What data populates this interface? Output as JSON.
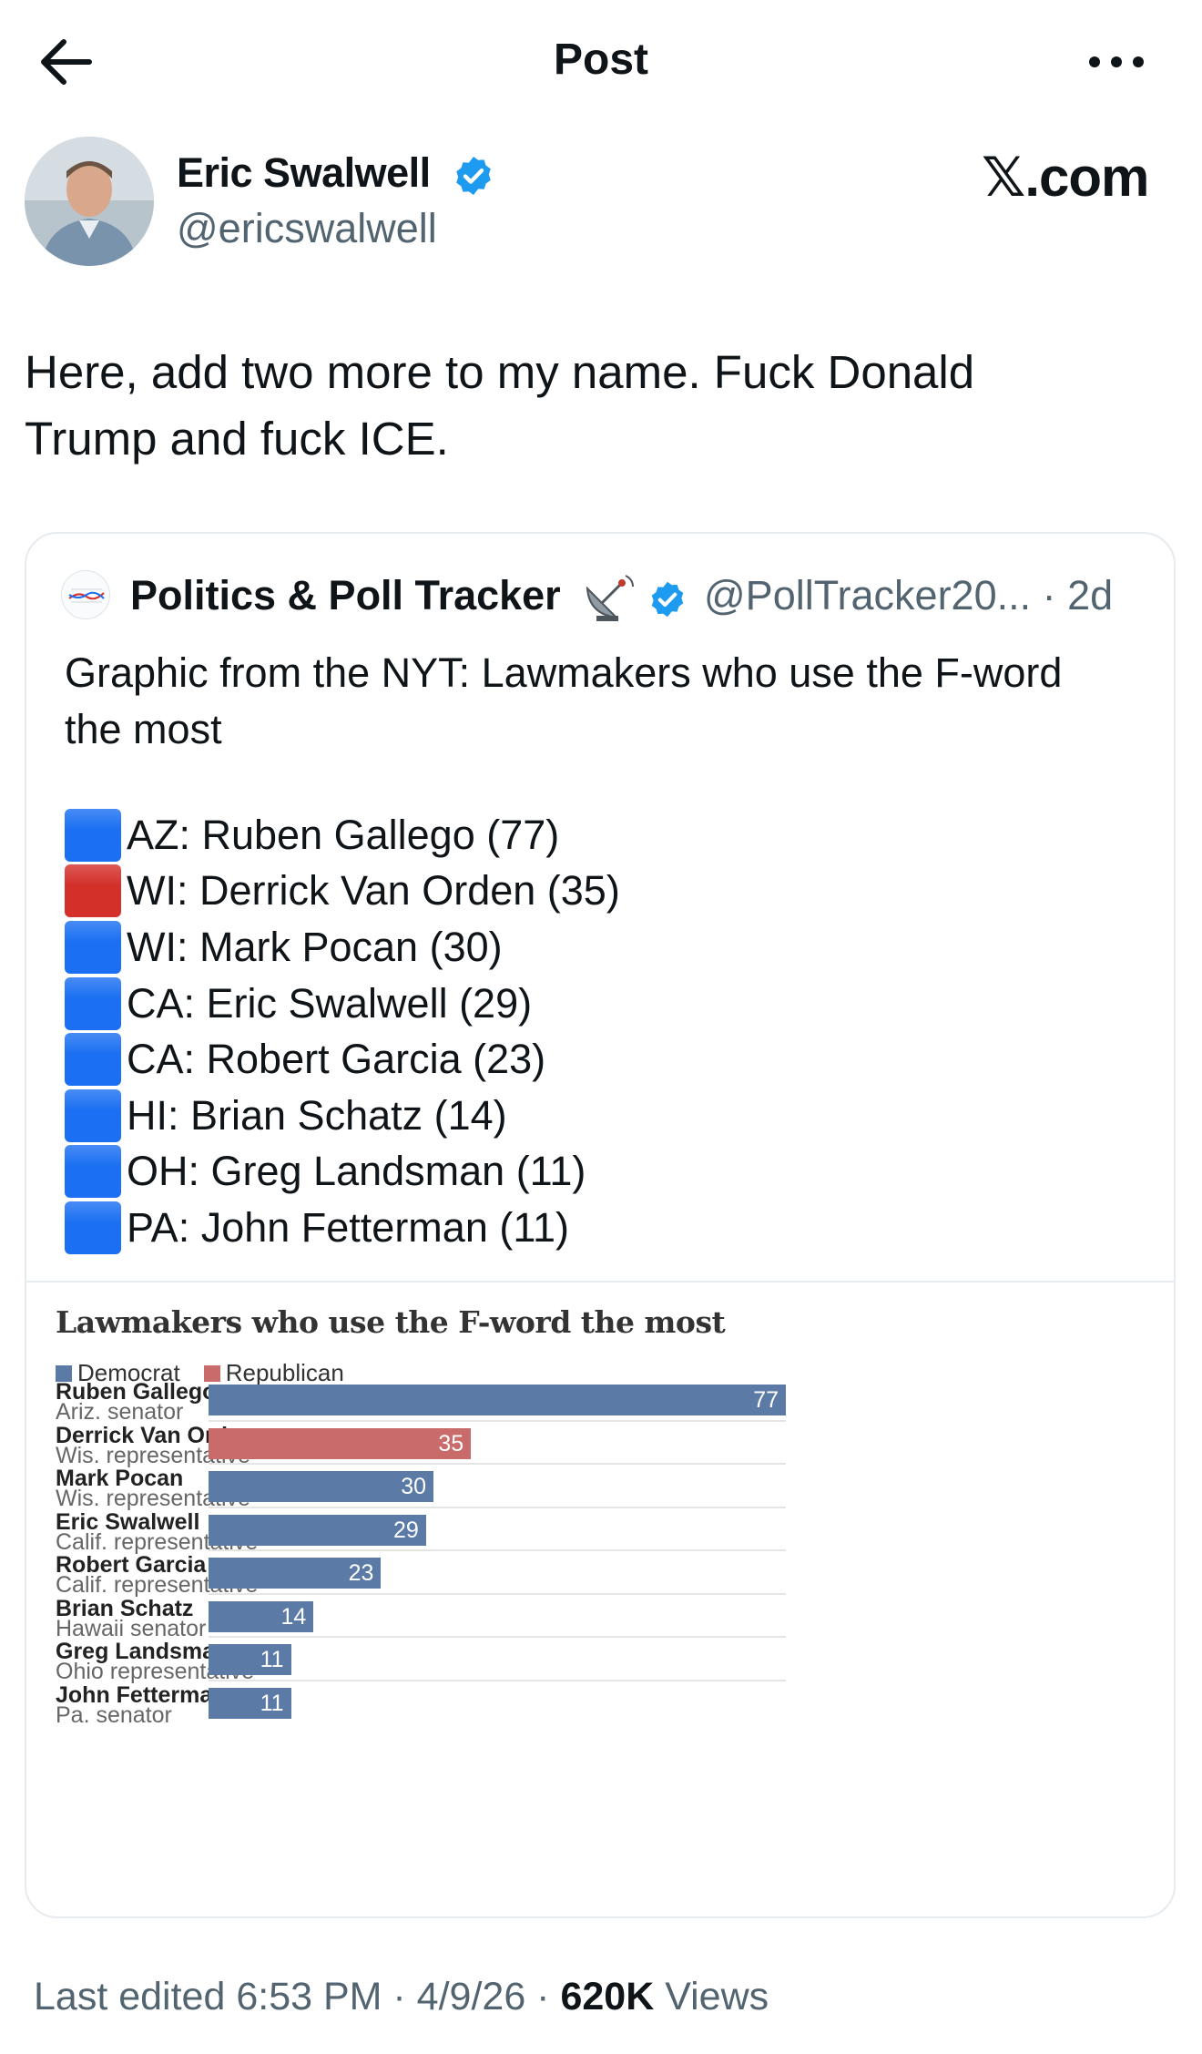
{
  "header": {
    "title": "Post"
  },
  "author": {
    "name": "Eric Swalwell",
    "handle": "@ericswalwell"
  },
  "brand": {
    "logo_text": "𝕏.com"
  },
  "tweet": {
    "text_line1": "Here, add two more to my name. Fuck Donald",
    "text_line2": "Trump and fuck ICE."
  },
  "quote": {
    "name": "Politics & Poll Tracker",
    "handle": "@PollTracker20... · 2d",
    "text_line1": "Graphic from the NYT: Lawmakers who use the F-word",
    "text_line2": "the most",
    "items": [
      {
        "party": "D",
        "text": "AZ: Ruben Gallego (77)"
      },
      {
        "party": "R",
        "text": "WI: Derrick Van Orden (35)"
      },
      {
        "party": "D",
        "text": "WI: Mark Pocan (30)"
      },
      {
        "party": "D",
        "text": "CA: Eric Swalwell (29)"
      },
      {
        "party": "D",
        "text": "CA: Robert Garcia (23)"
      },
      {
        "party": "D",
        "text": "HI: Brian Schatz (14)"
      },
      {
        "party": "D",
        "text": "OH: Greg Landsman (11)"
      },
      {
        "party": "D",
        "text": "PA: John Fetterman (11)"
      }
    ]
  },
  "colors": {
    "verified": "#1d9bf0",
    "square_democrat": "#1a6ff2",
    "square_republican": "#d4302a",
    "bar_democrat": "#5b7ba6",
    "bar_republican": "#c96b6b"
  },
  "chart_data": {
    "type": "bar",
    "orientation": "horizontal",
    "title": "Lawmakers who use the F-word the most",
    "legend": [
      "Democrat",
      "Republican"
    ],
    "legend_placement": "top-left",
    "xlim": [
      0,
      77
    ],
    "categories": [
      "Ruben Gallego",
      "Derrick Van Orden",
      "Mark Pocan",
      "Eric Swalwell",
      "Robert Garcia",
      "Brian Schatz",
      "Greg Landsman",
      "John Fetterman"
    ],
    "subtitles": [
      "Ariz. senator",
      "Wis. representative",
      "Wis. representative",
      "Calif. representative",
      "Calif. representative",
      "Hawaii senator",
      "Ohio representative",
      "Pa. senator"
    ],
    "parties": [
      "Democrat",
      "Republican",
      "Democrat",
      "Democrat",
      "Democrat",
      "Democrat",
      "Democrat",
      "Democrat"
    ],
    "values": [
      77,
      35,
      30,
      29,
      23,
      14,
      11,
      11
    ]
  },
  "footer": {
    "prefix": "Last edited 6:53 PM · 4/9/26 · ",
    "views_count": "620K",
    "views_label": " Views"
  }
}
